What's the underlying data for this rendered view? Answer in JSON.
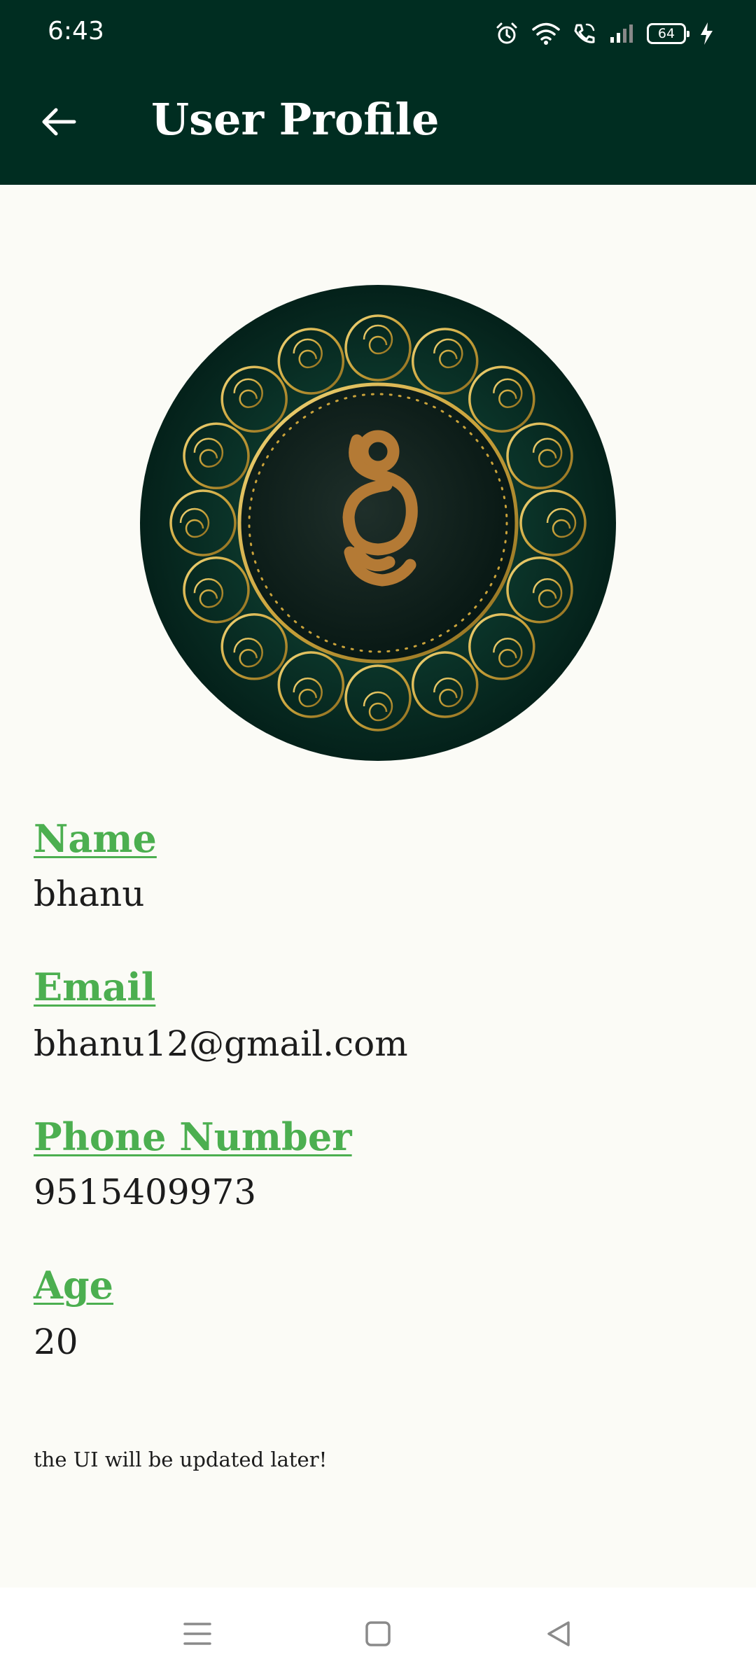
{
  "status_bar": {
    "time": "6:43",
    "battery_level": "64",
    "icons": [
      "alarm-icon",
      "wifi-icon",
      "wifi-calling-icon",
      "signal-icon",
      "battery-icon",
      "charging-icon"
    ]
  },
  "app_bar": {
    "title": "User Profile",
    "back_icon": "arrow-left-icon"
  },
  "colors": {
    "app_bar_bg": "#002D21",
    "background": "#FBFBF6",
    "label": "#4CAF50",
    "text": "#1c1c1c",
    "avatar_bg": "#06241c",
    "avatar_gold": "#C9A23A",
    "avatar_monogram": "#B47A35"
  },
  "profile": {
    "avatar_icon": "gold-mandala-monogram-avatar",
    "fields": {
      "name": {
        "label": "Name",
        "value": "bhanu"
      },
      "email": {
        "label": "Email",
        "value": "bhanu12@gmail.com"
      },
      "phone": {
        "label": "Phone Number",
        "value": "9515409973"
      },
      "age": {
        "label": "Age",
        "value": "20"
      }
    }
  },
  "footer_note": "the UI will be updated later!",
  "nav_bar": {
    "icons": [
      "menu-icon",
      "home-square-icon",
      "back-triangle-icon"
    ]
  }
}
